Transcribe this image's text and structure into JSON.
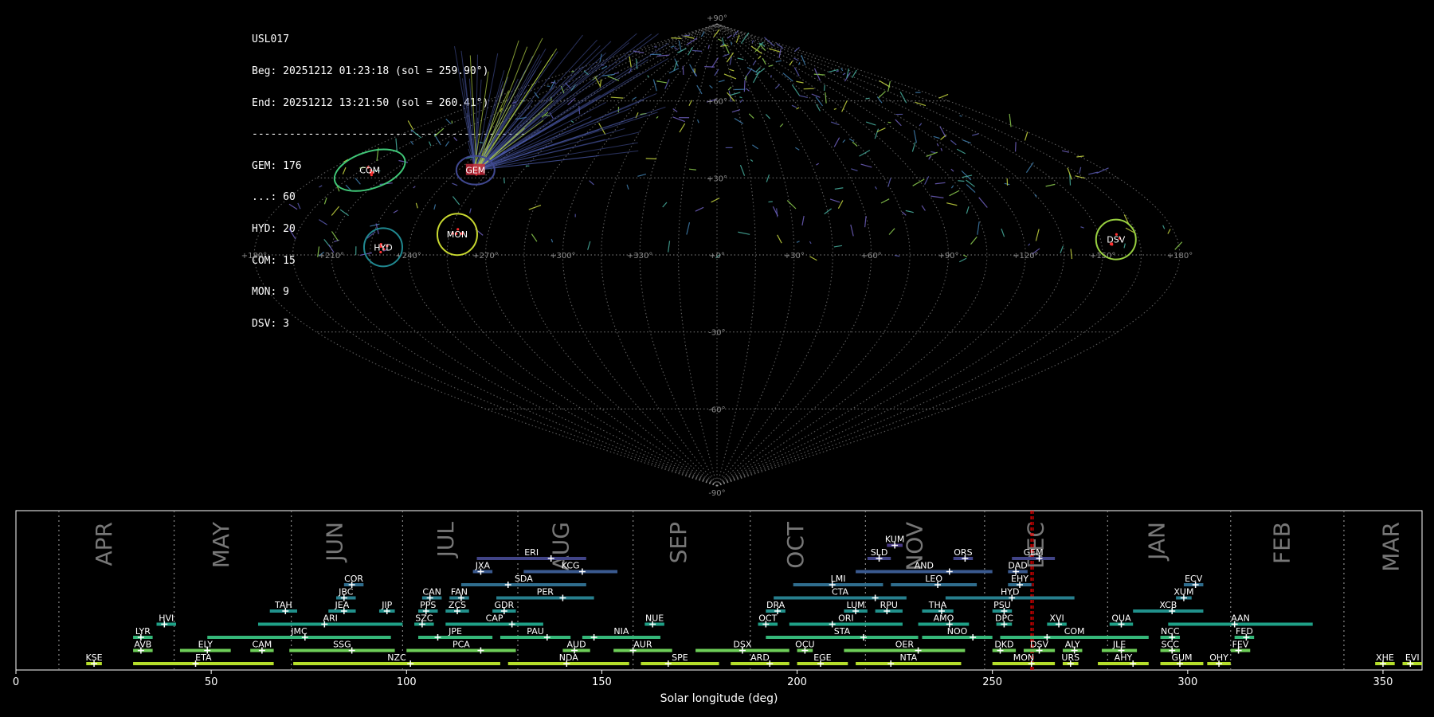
{
  "info": {
    "station": "USL017",
    "begin": "Beg: 20251212 01:23:18 (sol = 259.90°)",
    "end": "End: 20251212 13:21:50 (sol = 260.41°)",
    "separator": "--------------------------------------------",
    "counts": [
      "GEM: 176",
      "...: 60",
      "HYD: 20",
      "COM: 15",
      "MON: 9",
      "DSV: 3"
    ]
  },
  "colors": {
    "background": "#000000",
    "grid": "#9a9a9a",
    "current_marker": "#ff0000",
    "track": "#4a5aa8",
    "track_alt": "#b8d848"
  },
  "chart_data": [
    {
      "type": "scatter",
      "projection": "sinusoidal",
      "xlabel": "",
      "ylabel": "",
      "x_ticks": [
        "+180°",
        "+150°",
        "+120°",
        "+90°",
        "+60°",
        "+30°",
        "+0°",
        "+330°",
        "+300°",
        "+270°",
        "+240°",
        "+210°",
        "+180°"
      ],
      "y_ticks": [
        "+90°",
        "+60°",
        "+30°",
        "-30°",
        "-60°",
        "-90°"
      ],
      "radiants": [
        {
          "name": "COM",
          "ra": 161,
          "dec": 33,
          "color": "#40c878"
        },
        {
          "name": "GEM",
          "ra": 112,
          "dec": 33,
          "color": "#404890"
        },
        {
          "name": "MON",
          "ra": 102,
          "dec": 8,
          "color": "#c8d830"
        },
        {
          "name": "HYD",
          "ra": 130,
          "dec": 3,
          "color": "#208890"
        },
        {
          "name": "DSV",
          "ra": 204,
          "dec": 6,
          "color": "#98d040"
        }
      ]
    },
    {
      "type": "bar",
      "xlabel": "Solar longitude (deg)",
      "xlim": [
        0,
        360
      ],
      "x_ticks": [
        0,
        50,
        100,
        150,
        200,
        250,
        300,
        350
      ],
      "months": [
        {
          "name": "APR",
          "x": 24.5
        },
        {
          "name": "MAY",
          "x": 54.5
        },
        {
          "name": "JUN",
          "x": 83.5
        },
        {
          "name": "JUL",
          "x": 112
        },
        {
          "name": "AUG",
          "x": 141.5
        },
        {
          "name": "SEP",
          "x": 171.5
        },
        {
          "name": "OCT",
          "x": 201.5
        },
        {
          "name": "NOV",
          "x": 232
        },
        {
          "name": "DEC",
          "x": 263
        },
        {
          "name": "JAN",
          "x": 294
        },
        {
          "name": "FEB",
          "x": 326
        },
        {
          "name": "MAR",
          "x": 354
        }
      ],
      "month_boundaries": [
        11,
        40.5,
        70.5,
        99,
        128.5,
        158,
        188,
        217.5,
        248,
        279.5,
        311,
        340
      ],
      "current_sol": [
        259.9,
        260.41
      ],
      "showers": [
        {
          "name": "KUM",
          "start": 223,
          "end": 227,
          "peak": 225,
          "row": 9,
          "color": "#4a3a88"
        },
        {
          "name": "ERI",
          "start": 118,
          "end": 146,
          "peak": 137,
          "row": 8,
          "color": "#414487"
        },
        {
          "name": "SLD",
          "start": 218,
          "end": 224,
          "peak": 221,
          "row": 8,
          "color": "#414487"
        },
        {
          "name": "ORS",
          "start": 240,
          "end": 245,
          "peak": 243,
          "row": 8,
          "color": "#414487"
        },
        {
          "name": "GEM",
          "start": 255,
          "end": 266,
          "peak": 262,
          "row": 8,
          "color": "#414487"
        },
        {
          "name": "JXA",
          "start": 117,
          "end": 122,
          "peak": 119,
          "row": 7,
          "color": "#3a5a90"
        },
        {
          "name": "KCG",
          "start": 130,
          "end": 154,
          "peak": 145,
          "row": 7,
          "color": "#3a5a90"
        },
        {
          "name": "AND",
          "start": 215,
          "end": 250,
          "peak": 239,
          "row": 7,
          "color": "#3a5a90"
        },
        {
          "name": "DAD",
          "start": 254,
          "end": 259,
          "peak": 256,
          "row": 7,
          "color": "#3a5a90"
        },
        {
          "name": "COR",
          "start": 84,
          "end": 89,
          "peak": 86,
          "row": 6,
          "color": "#2f6d8e"
        },
        {
          "name": "SDA",
          "start": 114,
          "end": 146,
          "peak": 126,
          "row": 6,
          "color": "#2f6d8e"
        },
        {
          "name": "LMI",
          "start": 199,
          "end": 222,
          "peak": 209,
          "row": 6,
          "color": "#2f6d8e"
        },
        {
          "name": "LEO",
          "start": 224,
          "end": 246,
          "peak": 236,
          "row": 6,
          "color": "#2f6d8e"
        },
        {
          "name": "EHY",
          "start": 254,
          "end": 260,
          "peak": 257,
          "row": 6,
          "color": "#2f6d8e"
        },
        {
          "name": "ECV",
          "start": 299,
          "end": 304,
          "peak": 302,
          "row": 6,
          "color": "#2f6d8e"
        },
        {
          "name": "JBC",
          "start": 82,
          "end": 87,
          "peak": 84,
          "row": 5,
          "color": "#277f8e"
        },
        {
          "name": "CAN",
          "start": 104,
          "end": 109,
          "peak": 106,
          "row": 5,
          "color": "#277f8e"
        },
        {
          "name": "FAN",
          "start": 111,
          "end": 116,
          "peak": 114,
          "row": 5,
          "color": "#277f8e"
        },
        {
          "name": "PER",
          "start": 123,
          "end": 148,
          "peak": 140,
          "row": 5,
          "color": "#277f8e"
        },
        {
          "name": "CTA",
          "start": 194,
          "end": 228,
          "peak": 220,
          "row": 5,
          "color": "#277f8e"
        },
        {
          "name": "HYD",
          "start": 238,
          "end": 271,
          "peak": 255,
          "row": 5,
          "color": "#277f8e"
        },
        {
          "name": "XUM",
          "start": 297,
          "end": 301,
          "peak": 299,
          "row": 5,
          "color": "#277f8e"
        },
        {
          "name": "TAH",
          "start": 65,
          "end": 72,
          "peak": 69,
          "row": 4,
          "color": "#21918c"
        },
        {
          "name": "JEA",
          "start": 80,
          "end": 87,
          "peak": 84,
          "row": 4,
          "color": "#21918c"
        },
        {
          "name": "JIP",
          "start": 93,
          "end": 97,
          "peak": 95,
          "row": 4,
          "color": "#21918c"
        },
        {
          "name": "PPS",
          "start": 103,
          "end": 108,
          "peak": 105,
          "row": 4,
          "color": "#21918c"
        },
        {
          "name": "ZCS",
          "start": 110,
          "end": 116,
          "peak": 113,
          "row": 4,
          "color": "#21918c"
        },
        {
          "name": "GDR",
          "start": 122,
          "end": 128,
          "peak": 125,
          "row": 4,
          "color": "#21918c"
        },
        {
          "name": "DRA",
          "start": 192,
          "end": 197,
          "peak": 195,
          "row": 4,
          "color": "#21918c"
        },
        {
          "name": "LUM",
          "start": 212,
          "end": 218,
          "peak": 215,
          "row": 4,
          "color": "#21918c"
        },
        {
          "name": "RPU",
          "start": 220,
          "end": 227,
          "peak": 223,
          "row": 4,
          "color": "#21918c"
        },
        {
          "name": "THA",
          "start": 232,
          "end": 240,
          "peak": 237,
          "row": 4,
          "color": "#21918c"
        },
        {
          "name": "PSU",
          "start": 250,
          "end": 255,
          "peak": 253,
          "row": 4,
          "color": "#21918c"
        },
        {
          "name": "XCB",
          "start": 286,
          "end": 304,
          "peak": 296,
          "row": 4,
          "color": "#21918c"
        },
        {
          "name": "HVI",
          "start": 36,
          "end": 41,
          "peak": 38,
          "row": 3,
          "color": "#1fa187"
        },
        {
          "name": "ARI",
          "start": 62,
          "end": 99,
          "peak": 79,
          "row": 3,
          "color": "#1fa187"
        },
        {
          "name": "SZC",
          "start": 102,
          "end": 107,
          "peak": 104,
          "row": 3,
          "color": "#1fa187"
        },
        {
          "name": "CAP",
          "start": 110,
          "end": 135,
          "peak": 127,
          "row": 3,
          "color": "#1fa187"
        },
        {
          "name": "NUE",
          "start": 161,
          "end": 166,
          "peak": 163,
          "row": 3,
          "color": "#1fa187"
        },
        {
          "name": "OCT",
          "start": 190,
          "end": 195,
          "peak": 192,
          "row": 3,
          "color": "#1fa187"
        },
        {
          "name": "ORI",
          "start": 198,
          "end": 227,
          "peak": 209,
          "row": 3,
          "color": "#1fa187"
        },
        {
          "name": "AMO",
          "start": 231,
          "end": 244,
          "peak": 239,
          "row": 3,
          "color": "#1fa187"
        },
        {
          "name": "DPC",
          "start": 251,
          "end": 255,
          "peak": 253,
          "row": 3,
          "color": "#1fa187"
        },
        {
          "name": "XVI",
          "start": 264,
          "end": 269,
          "peak": 267,
          "row": 3,
          "color": "#1fa187"
        },
        {
          "name": "QUA",
          "start": 280,
          "end": 286,
          "peak": 283,
          "row": 3,
          "color": "#1fa187"
        },
        {
          "name": "AAN",
          "start": 295,
          "end": 332,
          "peak": 312,
          "row": 3,
          "color": "#1fa187"
        },
        {
          "name": "LYR",
          "start": 30,
          "end": 35,
          "peak": 32,
          "row": 2,
          "color": "#35b779"
        },
        {
          "name": "JMC",
          "start": 49,
          "end": 96,
          "peak": 74,
          "row": 2,
          "color": "#35b779"
        },
        {
          "name": "JPE",
          "start": 103,
          "end": 122,
          "peak": 108,
          "row": 2,
          "color": "#35b779"
        },
        {
          "name": "PAU",
          "start": 124,
          "end": 142,
          "peak": 136,
          "row": 2,
          "color": "#35b779"
        },
        {
          "name": "NIA",
          "start": 145,
          "end": 165,
          "peak": 148,
          "row": 2,
          "color": "#35b779"
        },
        {
          "name": "STA",
          "start": 192,
          "end": 231,
          "peak": 217,
          "row": 2,
          "color": "#35b779"
        },
        {
          "name": "NOO",
          "start": 232,
          "end": 250,
          "peak": 245,
          "row": 2,
          "color": "#35b779"
        },
        {
          "name": "COM",
          "start": 252,
          "end": 290,
          "peak": 264,
          "row": 2,
          "color": "#35b779"
        },
        {
          "name": "NCC",
          "start": 293,
          "end": 298,
          "peak": 296,
          "row": 2,
          "color": "#35b779"
        },
        {
          "name": "FED",
          "start": 312,
          "end": 317,
          "peak": 315,
          "row": 2,
          "color": "#35b779"
        },
        {
          "name": "AVB",
          "start": 30,
          "end": 35,
          "peak": 32,
          "row": 1,
          "color": "#6ece58"
        },
        {
          "name": "ELY",
          "start": 42,
          "end": 55,
          "peak": 49,
          "row": 1,
          "color": "#6ece58"
        },
        {
          "name": "CAM",
          "start": 60,
          "end": 66,
          "peak": 63,
          "row": 1,
          "color": "#6ece58"
        },
        {
          "name": "SSG",
          "start": 70,
          "end": 97,
          "peak": 86,
          "row": 1,
          "color": "#6ece58"
        },
        {
          "name": "PCA",
          "start": 100,
          "end": 128,
          "peak": 119,
          "row": 1,
          "color": "#6ece58"
        },
        {
          "name": "AUD",
          "start": 140,
          "end": 147,
          "peak": 143,
          "row": 1,
          "color": "#6ece58"
        },
        {
          "name": "AUR",
          "start": 153,
          "end": 168,
          "peak": 158,
          "row": 1,
          "color": "#6ece58"
        },
        {
          "name": "DSX",
          "start": 174,
          "end": 198,
          "peak": 186,
          "row": 1,
          "color": "#6ece58"
        },
        {
          "name": "OCU",
          "start": 200,
          "end": 204,
          "peak": 202,
          "row": 1,
          "color": "#6ece58"
        },
        {
          "name": "OER",
          "start": 212,
          "end": 243,
          "peak": 231,
          "row": 1,
          "color": "#6ece58"
        },
        {
          "name": "DKD",
          "start": 250,
          "end": 256,
          "peak": 252,
          "row": 1,
          "color": "#6ece58"
        },
        {
          "name": "DSV",
          "start": 258,
          "end": 266,
          "peak": 262,
          "row": 1,
          "color": "#6ece58"
        },
        {
          "name": "ALY",
          "start": 268,
          "end": 273,
          "peak": 271,
          "row": 1,
          "color": "#6ece58"
        },
        {
          "name": "JLE",
          "start": 278,
          "end": 287,
          "peak": 283,
          "row": 1,
          "color": "#6ece58"
        },
        {
          "name": "SCC",
          "start": 293,
          "end": 298,
          "peak": 296,
          "row": 1,
          "color": "#6ece58"
        },
        {
          "name": "FEV",
          "start": 311,
          "end": 316,
          "peak": 313,
          "row": 1,
          "color": "#6ece58"
        },
        {
          "name": "KSE",
          "start": 18,
          "end": 22,
          "peak": 20,
          "row": 0,
          "color": "#b5de2b"
        },
        {
          "name": "ETA",
          "start": 30,
          "end": 66,
          "peak": 46,
          "row": 0,
          "color": "#b5de2b"
        },
        {
          "name": "NZC",
          "start": 71,
          "end": 124,
          "peak": 101,
          "row": 0,
          "color": "#b5de2b"
        },
        {
          "name": "NDA",
          "start": 126,
          "end": 157,
          "peak": 141,
          "row": 0,
          "color": "#b5de2b"
        },
        {
          "name": "SPE",
          "start": 160,
          "end": 180,
          "peak": 167,
          "row": 0,
          "color": "#b5de2b"
        },
        {
          "name": "ARD",
          "start": 183,
          "end": 198,
          "peak": 193,
          "row": 0,
          "color": "#b5de2b"
        },
        {
          "name": "EGE",
          "start": 200,
          "end": 213,
          "peak": 206,
          "row": 0,
          "color": "#b5de2b"
        },
        {
          "name": "NTA",
          "start": 215,
          "end": 242,
          "peak": 224,
          "row": 0,
          "color": "#b5de2b"
        },
        {
          "name": "MON",
          "start": 250,
          "end": 266,
          "peak": 260,
          "row": 0,
          "color": "#b5de2b"
        },
        {
          "name": "URS",
          "start": 268,
          "end": 272,
          "peak": 270,
          "row": 0,
          "color": "#b5de2b"
        },
        {
          "name": "AHY",
          "start": 277,
          "end": 290,
          "peak": 286,
          "row": 0,
          "color": "#b5de2b"
        },
        {
          "name": "GUM",
          "start": 293,
          "end": 304,
          "peak": 298,
          "row": 0,
          "color": "#b5de2b"
        },
        {
          "name": "OHY",
          "start": 305,
          "end": 311,
          "peak": 308,
          "row": 0,
          "color": "#b5de2b"
        },
        {
          "name": "XHE",
          "start": 348,
          "end": 353,
          "peak": 350,
          "row": 0,
          "color": "#b5de2b"
        },
        {
          "name": "EVI",
          "start": 355,
          "end": 360,
          "peak": 357,
          "row": 0,
          "color": "#b5de2b"
        }
      ]
    }
  ]
}
